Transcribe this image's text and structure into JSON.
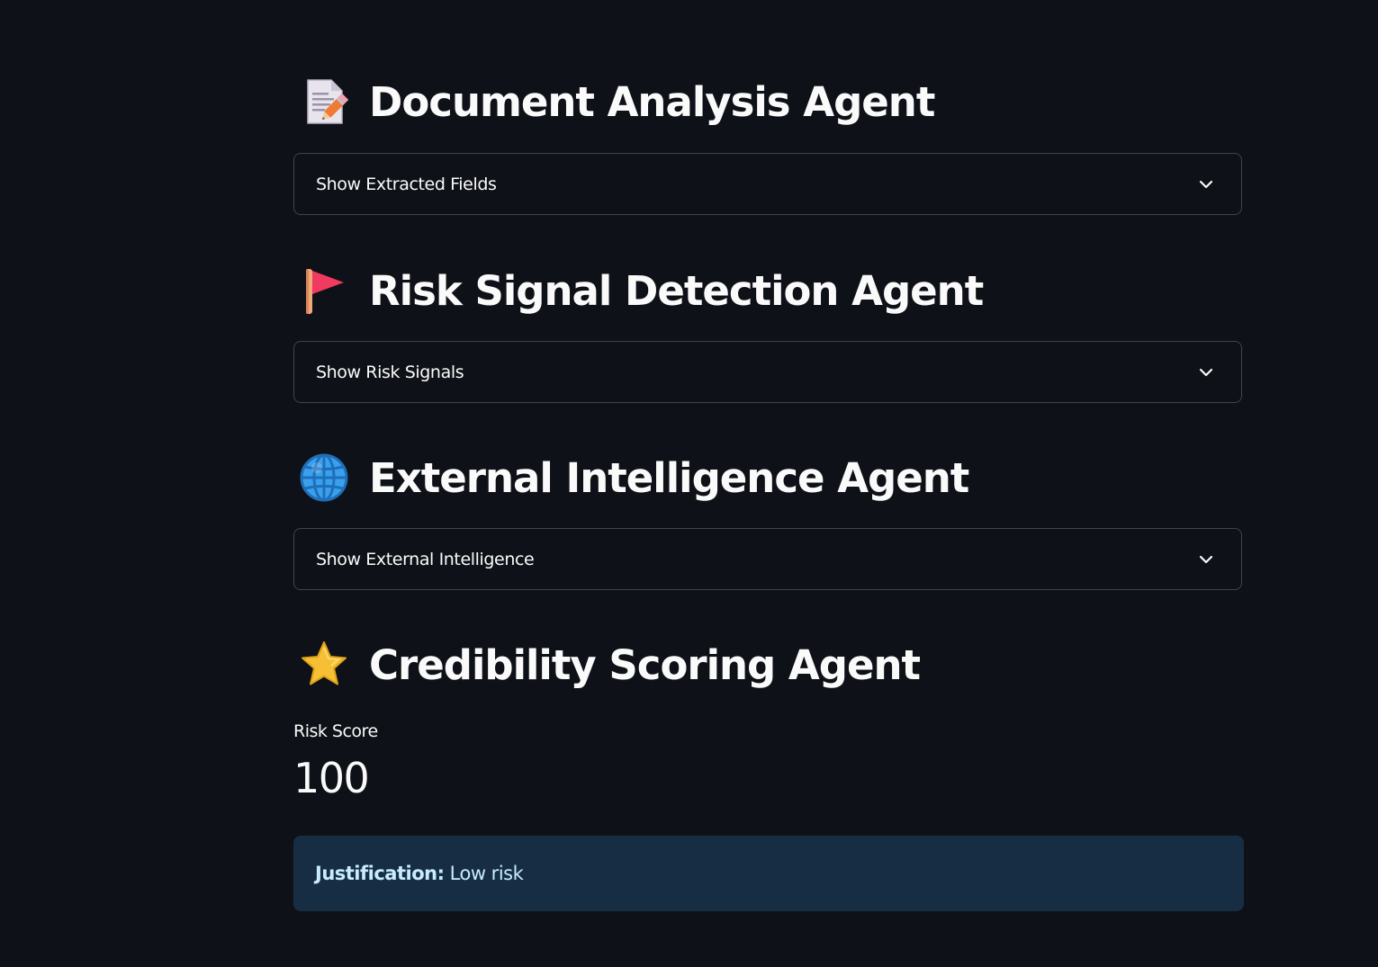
{
  "sections": [
    {
      "icon": "memo-icon",
      "title": "Document Analysis Agent",
      "expander_label": "Show Extracted Fields"
    },
    {
      "icon": "red-flag-icon",
      "title": "Risk Signal Detection Agent",
      "expander_label": "Show Risk Signals"
    },
    {
      "icon": "globe-icon",
      "title": "External Intelligence Agent",
      "expander_label": "Show External Intelligence"
    },
    {
      "icon": "star-icon",
      "title": "Credibility Scoring Agent"
    }
  ],
  "metric": {
    "label": "Risk Score",
    "value": "100"
  },
  "justification": {
    "label": "Justification:",
    "text": "Low risk"
  },
  "colors": {
    "background": "#0e1117",
    "text": "#fafafa",
    "info_background": "#172d43",
    "info_text": "#c7ebff"
  }
}
